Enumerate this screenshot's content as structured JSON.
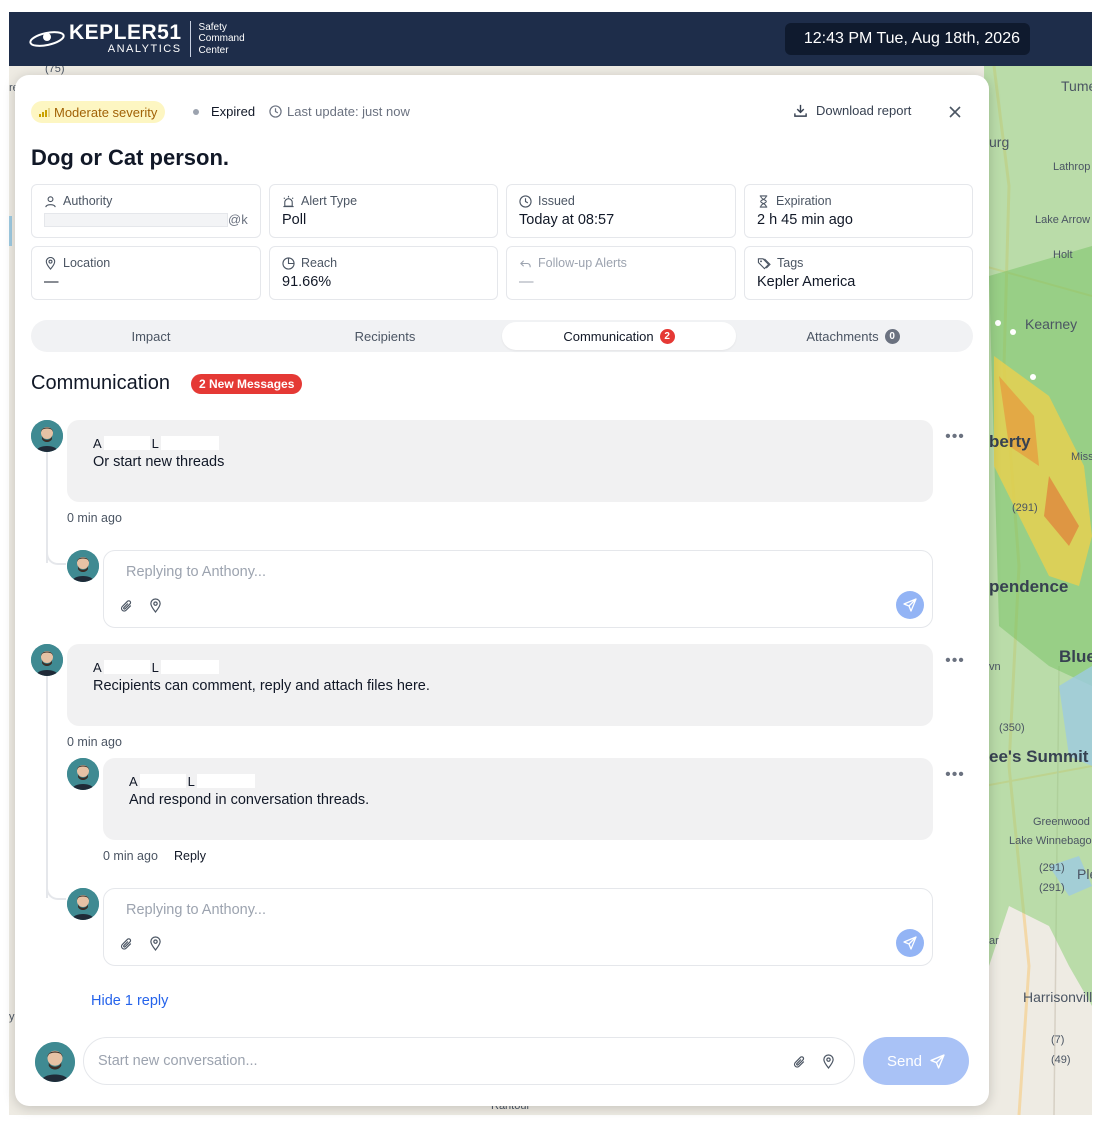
{
  "header": {
    "logo_word": "KEPLER51",
    "logo_sub": "ANALYTICS",
    "logo_tag_lines": [
      "Safety",
      "Command",
      "Center"
    ],
    "datetime": "12:43 PM Tue, Aug 18th, 2026"
  },
  "map": {
    "labels": [
      "(75)",
      "Tume",
      "urg",
      "Lathrop",
      "Lake Arrow",
      "Holt",
      "Kearney",
      "berty",
      "Miss",
      "(291)",
      "pendence",
      "Blue",
      "vn",
      "(350)",
      "ee's Summit",
      "Greenwood",
      "Lake Winnebago",
      "(291)",
      "(291)",
      "Ple",
      "ar",
      "Harrisonville",
      "(7)",
      "(49)",
      "y",
      "re",
      "Rantoul"
    ]
  },
  "alert": {
    "severity": "Moderate severity",
    "status": "Expired",
    "last_update": "Last update: just now",
    "download_label": "Download report",
    "title": "Dog or Cat person.",
    "cards": {
      "authority": {
        "label": "Authority",
        "value_suffix": "@k..."
      },
      "alert_type": {
        "label": "Alert Type",
        "value": "Poll"
      },
      "issued": {
        "label": "Issued",
        "value": "Today at 08:57"
      },
      "expiration": {
        "label": "Expiration",
        "value": "2 h 45 min ago"
      },
      "location": {
        "label": "Location",
        "value": "—"
      },
      "reach": {
        "label": "Reach",
        "value": "91.66%"
      },
      "follow_up": {
        "label": "Follow-up Alerts",
        "value": "—"
      },
      "tags": {
        "label": "Tags",
        "value": "Kepler America"
      }
    }
  },
  "tabs": [
    {
      "label": "Impact"
    },
    {
      "label": "Recipients"
    },
    {
      "label": "Communication",
      "count": "2"
    },
    {
      "label": "Attachments",
      "count": "0"
    }
  ],
  "communication": {
    "title": "Communication",
    "new_badge": "2 New Messages",
    "author_initials": [
      "A",
      "L"
    ],
    "threads": [
      {
        "text": "Or start new threads",
        "time": "0 min ago"
      },
      {
        "text": "Recipients can comment, reply and attach files here.",
        "time": "0 min ago"
      }
    ],
    "nested_reply": {
      "text": "And respond in conversation threads.",
      "time": "0 min ago",
      "reply_label": "Reply"
    },
    "reply_placeholder": "Replying to Anthony...",
    "hide_replies": "Hide 1 reply",
    "new_conv_placeholder": "Start new conversation...",
    "send_label": "Send"
  },
  "colors": {
    "header_bg": "#1e2d4a",
    "severity_bg": "#fdf6c2",
    "badge_red": "#e53935",
    "link_blue": "#2563eb",
    "send_disabled": "#a9c2f6"
  }
}
